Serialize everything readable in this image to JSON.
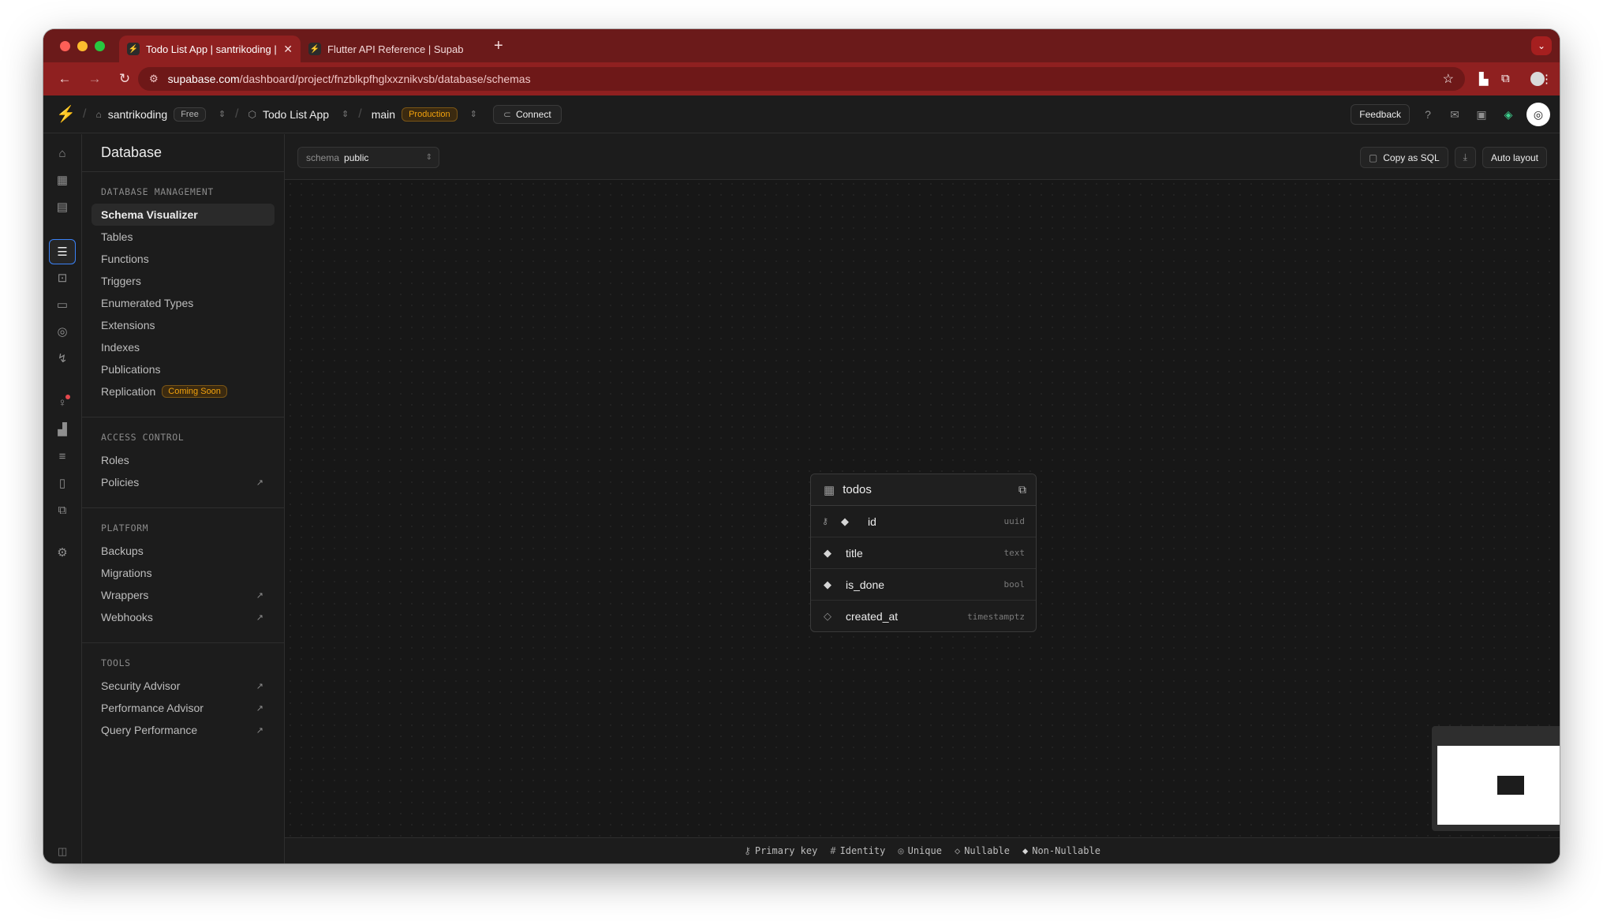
{
  "browser": {
    "tabs": [
      {
        "title": "Todo List App | santrikoding |",
        "active": true
      },
      {
        "title": "Flutter API Reference | Supab",
        "active": false
      }
    ],
    "url_host": "supabase.com",
    "url_path": "/dashboard/project/fnzblkpfhglxxznikvsb/database/schemas"
  },
  "header": {
    "org": "santrikoding",
    "org_plan": "Free",
    "project": "Todo List App",
    "branch": "main",
    "branch_env": "Production",
    "connect": "Connect",
    "feedback": "Feedback"
  },
  "sidebar": {
    "title": "Database",
    "sections": [
      {
        "heading": "DATABASE MANAGEMENT",
        "items": [
          {
            "label": "Schema Visualizer",
            "selected": true
          },
          {
            "label": "Tables"
          },
          {
            "label": "Functions"
          },
          {
            "label": "Triggers"
          },
          {
            "label": "Enumerated Types"
          },
          {
            "label": "Extensions"
          },
          {
            "label": "Indexes"
          },
          {
            "label": "Publications"
          },
          {
            "label": "Replication",
            "badge": "Coming Soon"
          }
        ]
      },
      {
        "heading": "ACCESS CONTROL",
        "items": [
          {
            "label": "Roles"
          },
          {
            "label": "Policies",
            "external": true
          }
        ]
      },
      {
        "heading": "PLATFORM",
        "items": [
          {
            "label": "Backups"
          },
          {
            "label": "Migrations"
          },
          {
            "label": "Wrappers",
            "external": true
          },
          {
            "label": "Webhooks",
            "external": true
          }
        ]
      },
      {
        "heading": "TOOLS",
        "items": [
          {
            "label": "Security Advisor",
            "external": true
          },
          {
            "label": "Performance Advisor",
            "external": true
          },
          {
            "label": "Query Performance",
            "external": true
          }
        ]
      }
    ]
  },
  "toolbar": {
    "schema_label": "schema",
    "schema_value": "public",
    "copy_sql": "Copy as SQL",
    "auto_layout": "Auto layout"
  },
  "table": {
    "name": "todos",
    "columns": [
      {
        "name": "id",
        "type": "uuid",
        "primary_key": true,
        "nullable": false
      },
      {
        "name": "title",
        "type": "text",
        "primary_key": false,
        "nullable": false
      },
      {
        "name": "is_done",
        "type": "bool",
        "primary_key": false,
        "nullable": false
      },
      {
        "name": "created_at",
        "type": "timestamptz",
        "primary_key": false,
        "nullable": true
      }
    ]
  },
  "legend": {
    "primary_key": "Primary key",
    "identity": "Identity",
    "unique": "Unique",
    "nullable": "Nullable",
    "non_nullable": "Non-Nullable"
  },
  "colors": {
    "brand": "#3ecf8e",
    "browser_chrome": "#8f2020",
    "badge_warning": "#f1a10d",
    "active_rail_border": "#3b82f6"
  }
}
